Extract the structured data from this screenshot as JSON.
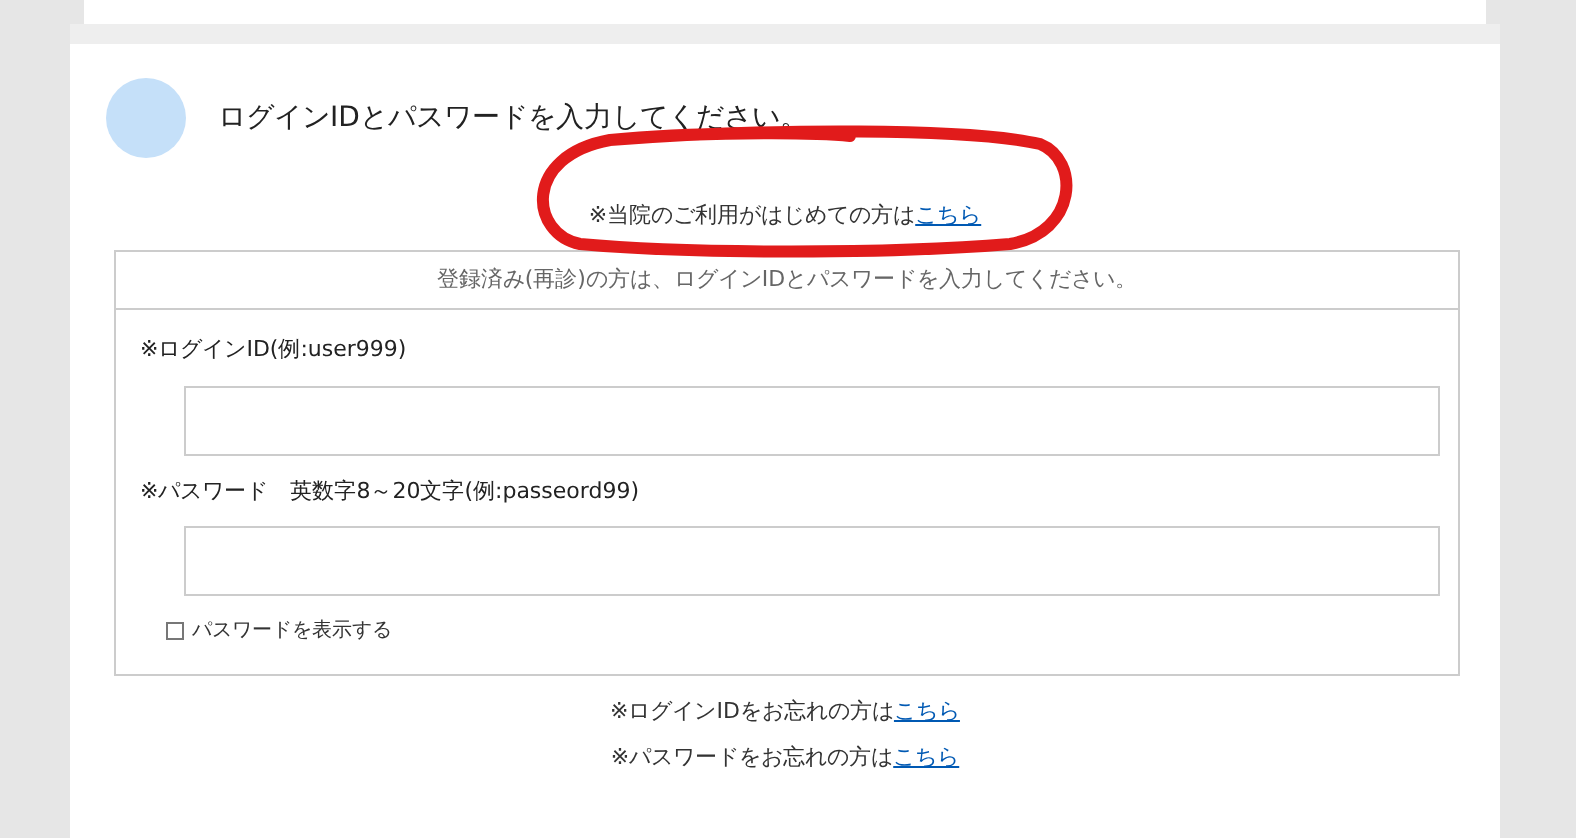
{
  "heading": "ログインIDとパスワードを入力してください。",
  "first_visit_note": {
    "text": "※当院のご利用がはじめての方は",
    "link": "こちら"
  },
  "form": {
    "caption": "登録済み(再診)の方は、ログインIDとパスワードを入力してください。",
    "fields": [
      {
        "label": "※ログインID(例:user999)"
      },
      {
        "label": "※パスワード　英数字8～20文字(例:passeord99)"
      }
    ],
    "show_password": {
      "label": "パスワードを表示する",
      "checked": false
    }
  },
  "help_links": [
    {
      "text": "※ログインIDをお忘れの方は",
      "link": "こちら"
    },
    {
      "text": "※パスワードをお忘れの方は",
      "link": "こちら"
    }
  ],
  "annotation": {
    "kind": "circle"
  }
}
